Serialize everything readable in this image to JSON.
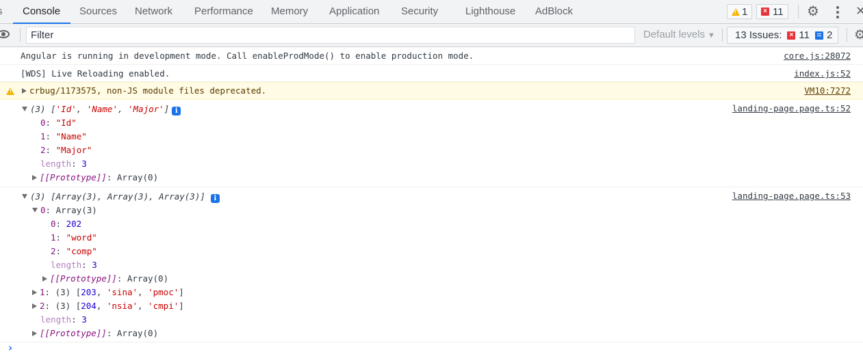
{
  "tabs": [
    {
      "label": "s",
      "active": false
    },
    {
      "label": "Console",
      "active": true
    },
    {
      "label": "Sources",
      "active": false
    },
    {
      "label": "Network",
      "active": false
    },
    {
      "label": "Performance",
      "active": false
    },
    {
      "label": "Memory",
      "active": false
    },
    {
      "label": "Application",
      "active": false
    },
    {
      "label": "Security",
      "active": false
    },
    {
      "label": "Lighthouse",
      "active": false
    },
    {
      "label": "AdBlock",
      "active": false
    }
  ],
  "header_badges": {
    "warnings": "1",
    "errors": "11"
  },
  "header_icons": {
    "settings": "gear-icon",
    "more": "kebab-icon",
    "close": "close-icon"
  },
  "toolbar": {
    "filter_placeholder": "Filter",
    "filter_value": "",
    "levels_label": "Default levels",
    "issues_label": "13 Issues:",
    "issues_errors": "11",
    "issues_info": "2"
  },
  "messages": [
    {
      "text": "Angular is running in development mode. Call enableProdMode() to enable production mode.",
      "source": "core.js:28072"
    },
    {
      "text": "[WDS] Live Reloading enabled.",
      "source": "index.js:52"
    },
    {
      "text": "crbug/1173575, non-JS module files deprecated.",
      "source": "VM10:7272",
      "level": "warning"
    }
  ],
  "log1": {
    "source": "landing-page.page.ts:52",
    "summary_count": "(3)",
    "summary_items": [
      "'Id'",
      "'Name'",
      "'Major'"
    ],
    "entries": [
      {
        "key": "0",
        "value": "\"Id\""
      },
      {
        "key": "1",
        "value": "\"Name\""
      },
      {
        "key": "2",
        "value": "\"Major\""
      }
    ],
    "length_key": "length",
    "length_value": "3",
    "proto_key": "[[Prototype]]",
    "proto_value": "Array(0)"
  },
  "log2": {
    "source": "landing-page.page.ts:53",
    "summary": "(3) [Array(3), Array(3), Array(3)]",
    "item0": {
      "key": "0",
      "value": "Array(3)",
      "entries": [
        {
          "key": "0",
          "value": "202",
          "type": "number"
        },
        {
          "key": "1",
          "value": "\"word\"",
          "type": "string"
        },
        {
          "key": "2",
          "value": "\"comp\"",
          "type": "string"
        }
      ],
      "length_key": "length",
      "length_value": "3",
      "proto_key": "[[Prototype]]",
      "proto_value": "Array(0)"
    },
    "item1": {
      "key": "1",
      "count": "(3)",
      "num": "203",
      "s1": "'sina'",
      "s2": "'pmoc'"
    },
    "item2": {
      "key": "2",
      "count": "(3)",
      "num": "204",
      "s1": "'nsia'",
      "s2": "'cmpi'"
    },
    "length_key": "length",
    "length_value": "3",
    "proto_key": "[[Prototype]]",
    "proto_value": "Array(0)"
  },
  "prompt_symbol": "›"
}
